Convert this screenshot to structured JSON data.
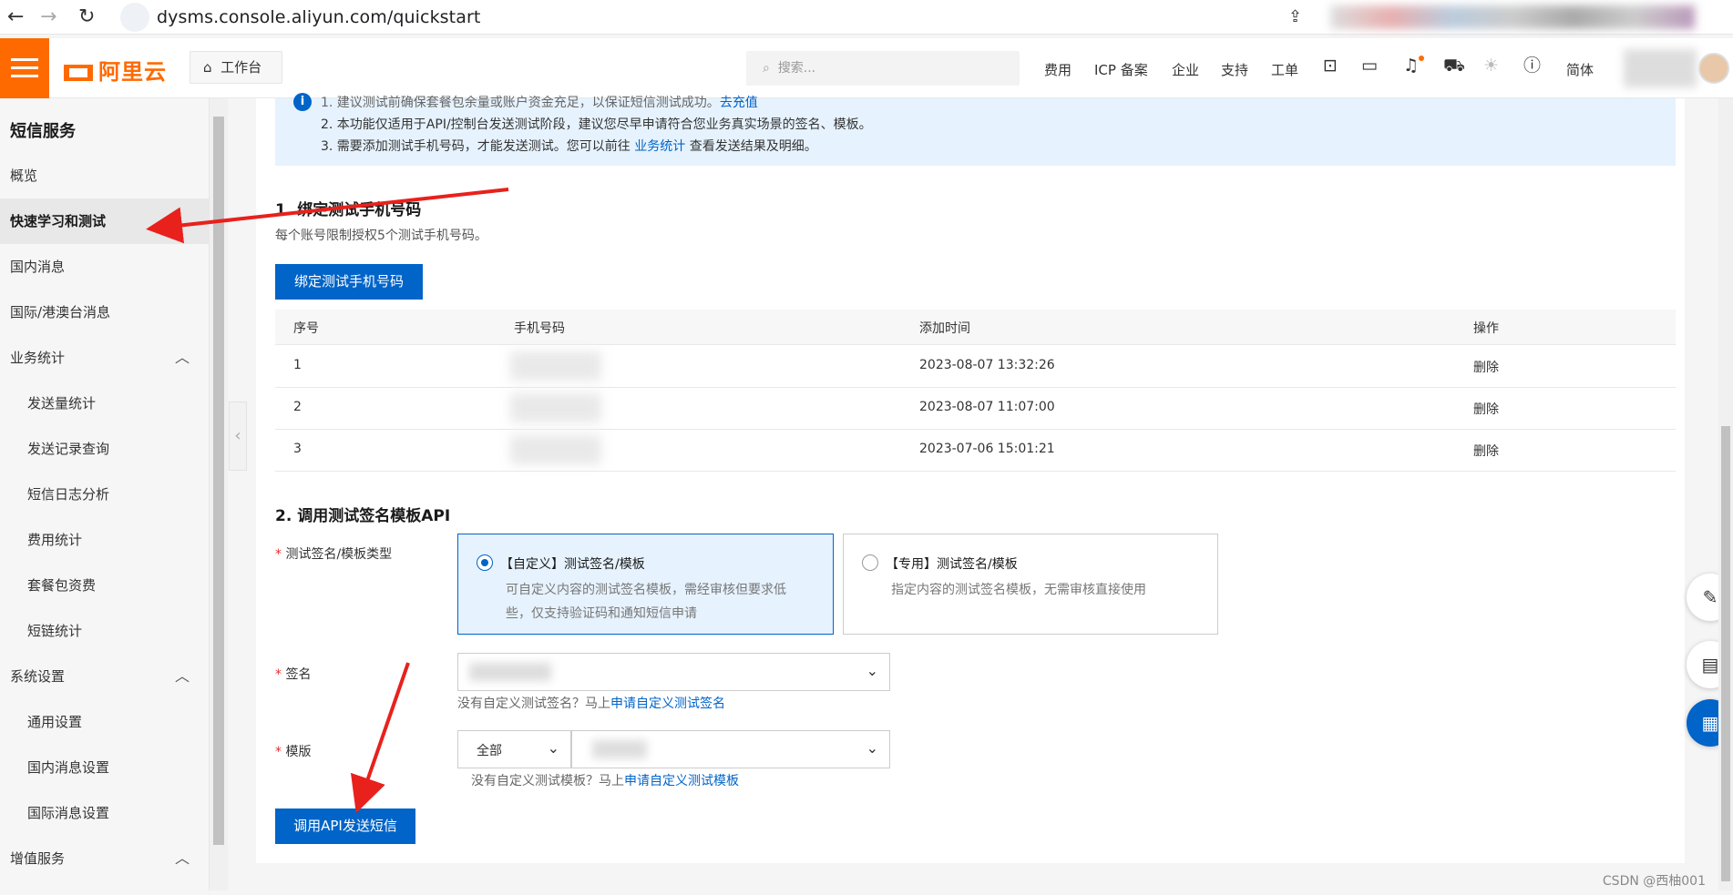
{
  "browser": {
    "url": "dysms.console.aliyun.com/quickstart",
    "back_icon": "←",
    "forward_icon": "→",
    "reload_icon": "↻"
  },
  "topbar": {
    "logo": "阿里云",
    "workbench": "工作台",
    "search_placeholder": "搜索...",
    "nav": [
      "费用",
      "ICP 备案",
      "企业",
      "支持",
      "工单"
    ],
    "lang": "简体",
    "accent": "#ff6a00"
  },
  "sidebar": {
    "title": "短信服务",
    "items": [
      {
        "label": "概览"
      },
      {
        "label": "快速学习和测试",
        "active": true
      },
      {
        "label": "国内消息"
      },
      {
        "label": "国际/港澳台消息"
      },
      {
        "label": "业务统计",
        "expandable": true
      },
      {
        "label": "发送量统计",
        "sub": true
      },
      {
        "label": "发送记录查询",
        "sub": true
      },
      {
        "label": "短信日志分析",
        "sub": true
      },
      {
        "label": "费用统计",
        "sub": true
      },
      {
        "label": "套餐包资费",
        "sub": true
      },
      {
        "label": "短链统计",
        "sub": true
      },
      {
        "label": "系统设置",
        "expandable": true
      },
      {
        "label": "通用设置",
        "sub": true
      },
      {
        "label": "国内消息设置",
        "sub": true
      },
      {
        "label": "国际消息设置",
        "sub": true
      },
      {
        "label": "增值服务",
        "expandable": true
      }
    ]
  },
  "notice": {
    "line1": "1. 建议测试前确保套餐包余量或账户资金充足，以保证短信测试成功。",
    "line1_link": "去充值",
    "line2": "2. 本功能仅适用于API/控制台发送测试阶段，建议您尽早申请符合您业务真实场景的签名、模板。",
    "line3a": "3. 需要添加测试手机号码，才能发送测试。您可以前往",
    "line3_link": "业务统计",
    "line3b": "查看发送结果及明细。"
  },
  "section1": {
    "title": "1. 绑定测试手机号码",
    "desc": "每个账号限制授权5个测试手机号码。",
    "button": "绑定测试手机号码",
    "table": {
      "headers": [
        "序号",
        "手机号码",
        "添加时间",
        "操作"
      ],
      "rows": [
        {
          "no": "1",
          "time": "2023-08-07 13:32:26",
          "action": "删除"
        },
        {
          "no": "2",
          "time": "2023-08-07 11:07:00",
          "action": "删除"
        },
        {
          "no": "3",
          "time": "2023-07-06 15:01:21",
          "action": "删除"
        }
      ]
    }
  },
  "section2": {
    "title": "2. 调用测试签名模板API",
    "type_label": "测试签名/模板类型",
    "option1_title": "【自定义】测试签名/模板",
    "option1_desc1": "可自定义内容的测试签名模板，需经审核但要求低",
    "option1_desc2": "些，仅支持验证码和通知短信申请",
    "option2_title": "【专用】测试签名/模板",
    "option2_desc": "指定内容的测试签名模板，无需审核直接使用",
    "sign_label": "签名",
    "sign_hint": "没有自定义测试签名？马上",
    "sign_link": "申请自定义测试签名",
    "template_label": "模版",
    "template_filter": "全部",
    "template_hint": "没有自定义测试模板？马上",
    "template_link": "申请自定义测试模板",
    "send_button": "调用API发送短信"
  },
  "watermark": "CSDN @西柚001"
}
